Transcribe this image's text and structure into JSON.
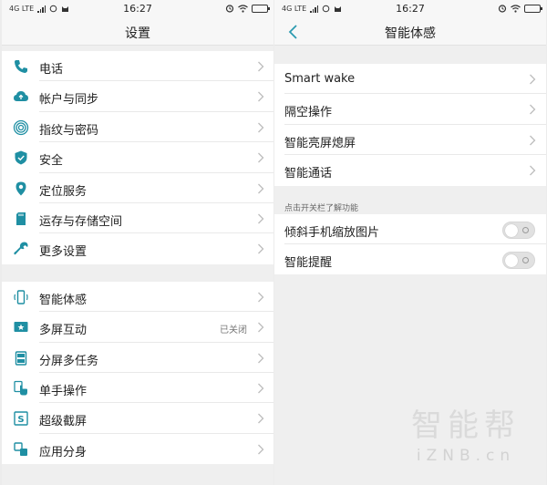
{
  "colors": {
    "accent": "#2d9bb0",
    "icon_teal": "#1f8fa3",
    "chevron": "#bdbdbd",
    "status_gray": "#777777"
  },
  "statusbar": {
    "network": "4G LTE",
    "time": "16:27"
  },
  "left": {
    "title": "设置",
    "group1": [
      {
        "label": "电话",
        "icon": "phone-icon"
      },
      {
        "label": "帐户与同步",
        "icon": "cloud-sync-icon"
      },
      {
        "label": "指纹与密码",
        "icon": "fingerprint-icon"
      },
      {
        "label": "安全",
        "icon": "shield-icon"
      },
      {
        "label": "定位服务",
        "icon": "location-pin-icon"
      },
      {
        "label": "运存与存储空间",
        "icon": "sd-card-icon"
      },
      {
        "label": "更多设置",
        "icon": "wrench-icon"
      }
    ],
    "group2": [
      {
        "label": "智能体感",
        "icon": "smart-motion-icon"
      },
      {
        "label": "多屏互动",
        "icon": "multi-screen-icon",
        "status": "已关闭"
      },
      {
        "label": "分屏多任务",
        "icon": "split-screen-icon"
      },
      {
        "label": "单手操作",
        "icon": "one-hand-icon"
      },
      {
        "label": "超级截屏",
        "icon": "screenshot-icon"
      },
      {
        "label": "应用分身",
        "icon": "app-clone-icon"
      }
    ]
  },
  "right": {
    "title": "智能体感",
    "group1": [
      {
        "label": "Smart wake"
      },
      {
        "label": "隔空操作"
      },
      {
        "label": "智能亮屏熄屏"
      },
      {
        "label": "智能通话"
      }
    ],
    "note": "点击开关栏了解功能",
    "toggles": [
      {
        "label": "倾斜手机缩放图片",
        "on": false
      },
      {
        "label": "智能提醒",
        "on": false
      }
    ]
  },
  "watermark": {
    "cn": "智能帮",
    "en": "iZNB.cn"
  }
}
